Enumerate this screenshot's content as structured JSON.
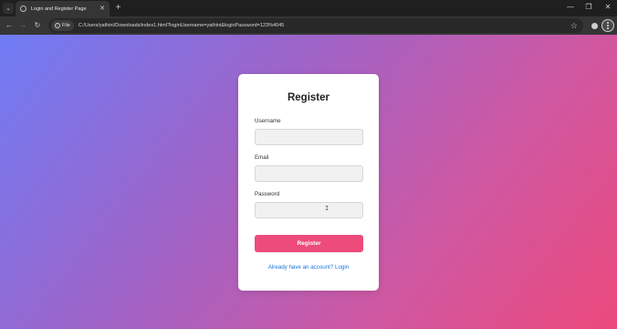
{
  "browser": {
    "tab_title": "Login and Register Page",
    "url_scheme_label": "File",
    "url": "C:/Users/yathini/Downloads/index1.html?loginUsername=yathini&loginPassword=123%4045"
  },
  "form": {
    "title": "Register",
    "username_label": "Username",
    "username_value": "",
    "email_label": "Email",
    "email_value": "",
    "password_label": "Password",
    "password_value": "",
    "submit_label": "Register",
    "switch_link": "Already have an account? Login"
  },
  "colors": {
    "gradient_start": "#6f7cf5",
    "gradient_mid": "#b75db4",
    "gradient_end": "#ec4a7c",
    "button": "#ec4b7b",
    "link": "#1a73d9"
  }
}
